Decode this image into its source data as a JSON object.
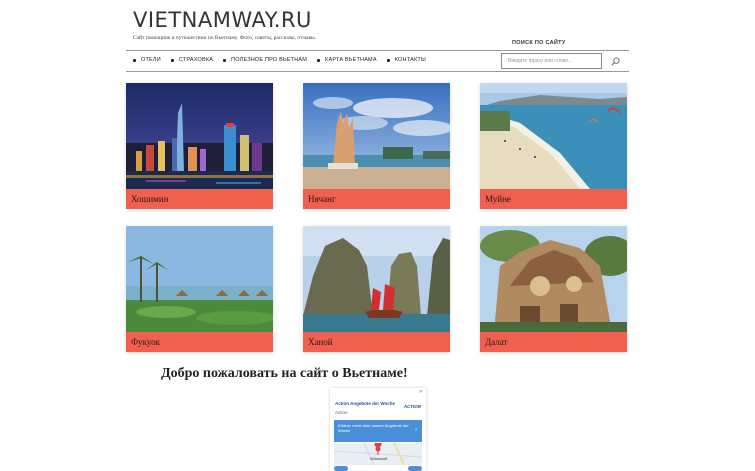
{
  "header": {
    "site_title": "VIETNAMWAY.RU",
    "tagline": "Сайт помощник в путешествии по Вьетнаму. Фото, советы, рассказы, отзывы.",
    "search_title": "ПОИСК ПО САЙТУ",
    "search_placeholder": "Введите фразу или слово...",
    "search_icon": "search-icon"
  },
  "nav": {
    "items": [
      {
        "label": "ОТЕЛИ"
      },
      {
        "label": "СТРАХОВКА"
      },
      {
        "label": "ПОЛЕЗНОЕ ПРО ВЬЕТНАМ"
      },
      {
        "label": "КАРТА ВЬЕТНАМА"
      },
      {
        "label": "КОНТАКТЫ"
      }
    ]
  },
  "tiles": [
    {
      "caption": "Хошимин",
      "image": "ho-chi-minh-city-night-skyline"
    },
    {
      "caption": "Нячанг",
      "image": "nha-trang-lotus-tower-beach"
    },
    {
      "caption": "Муйне",
      "image": "mui-ne-beach-kitesurf"
    },
    {
      "caption": "Фукуок",
      "image": "phu-quoc-beach-palms"
    },
    {
      "caption": "Ханой",
      "image": "ha-long-bay-junk-boat"
    },
    {
      "caption": "Далат",
      "image": "dalat-crazy-house"
    }
  ],
  "main": {
    "welcome": "Добро пожаловать на сайт о Вьетнаме!"
  },
  "ad": {
    "close": "✕",
    "title": "Action Angebote der Woche",
    "logo": "ACTION",
    "sub": "Action",
    "card_text": "Erfahre mehr über unsere Angebote der Woche",
    "card_arrow": "›",
    "map_label": "Wünsdorf"
  },
  "colors": {
    "caption_bg": "#f0604f",
    "rule": "#999999",
    "ad_blue": "#4a90d9"
  }
}
